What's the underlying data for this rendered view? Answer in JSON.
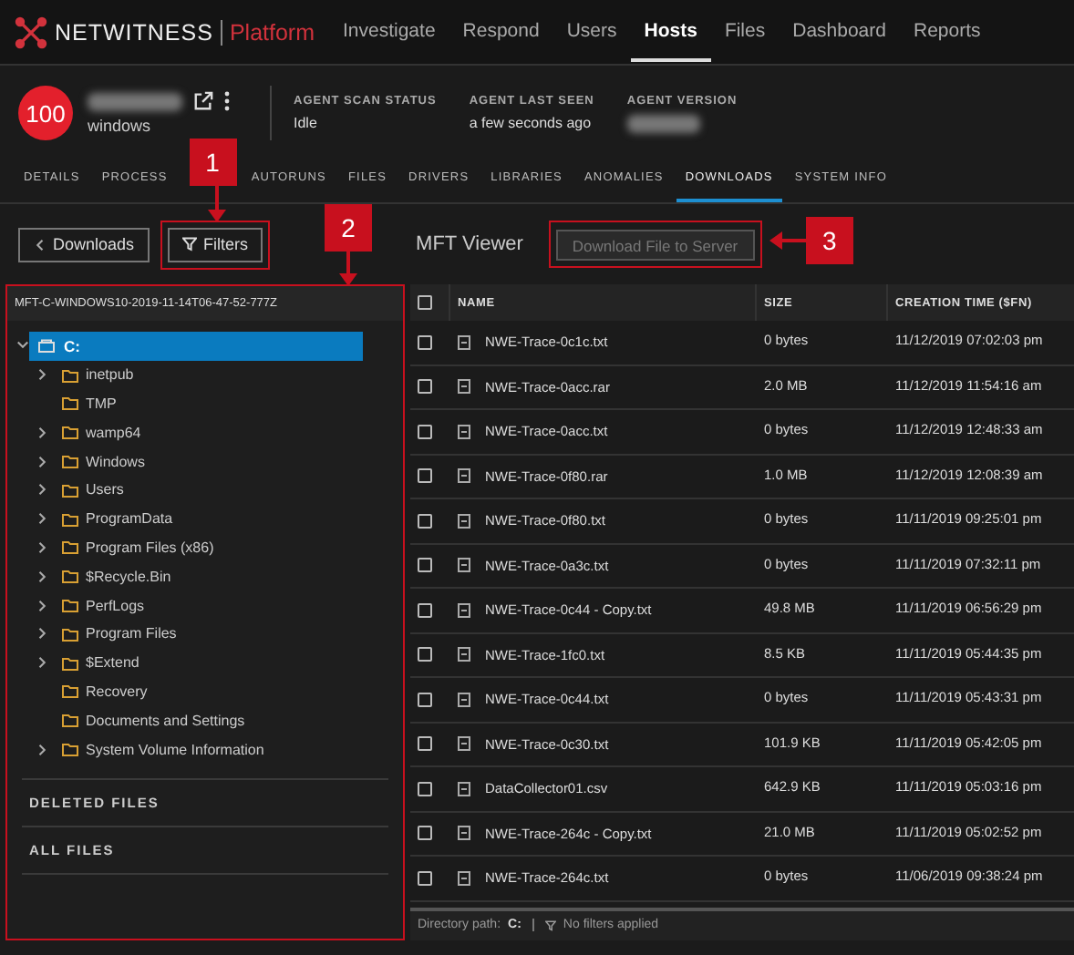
{
  "nav": {
    "brand": "NETWITNESS",
    "product": "Platform",
    "items": [
      {
        "label": "Investigate",
        "selected": false
      },
      {
        "label": "Respond",
        "selected": false
      },
      {
        "label": "Users",
        "selected": false
      },
      {
        "label": "Hosts",
        "selected": true
      },
      {
        "label": "Files",
        "selected": false
      },
      {
        "label": "Dashboard",
        "selected": false
      },
      {
        "label": "Reports",
        "selected": false
      }
    ]
  },
  "host": {
    "score": "100",
    "os": "windows",
    "fields": [
      {
        "label": "AGENT SCAN STATUS",
        "value": "Idle"
      },
      {
        "label": "AGENT LAST SEEN",
        "value": "a few seconds ago"
      },
      {
        "label": "AGENT VERSION"
      }
    ]
  },
  "tabs": [
    {
      "label": "DETAILS",
      "selected": false
    },
    {
      "label": "PROCESS",
      "selected": false
    },
    {
      "label": "AUTORUNS",
      "selected": false
    },
    {
      "label": "FILES",
      "selected": false
    },
    {
      "label": "DRIVERS",
      "selected": false
    },
    {
      "label": "LIBRARIES",
      "selected": false
    },
    {
      "label": "ANOMALIES",
      "selected": false
    },
    {
      "label": "DOWNLOADS",
      "selected": true
    },
    {
      "label": "SYSTEM INFO",
      "selected": false
    }
  ],
  "toolbar": {
    "back_button": "Downloads",
    "filter_button": {
      "label": "Filters",
      "callout": "1"
    },
    "title": "MFT Viewer",
    "download_button": {
      "label": "Download File to Server",
      "disabled": true,
      "callout": "3"
    }
  },
  "tree": {
    "callout": "2",
    "title": "MFT-C-WINDOWS10-2019-11-14T06-47-52-777Z",
    "root": {
      "label": "C:",
      "selected": true,
      "expanded": true,
      "children": [
        {
          "label": "inetpub",
          "expandable": true
        },
        {
          "label": "TMP",
          "expandable": false
        },
        {
          "label": "wamp64",
          "expandable": true
        },
        {
          "label": "Windows",
          "expandable": true
        },
        {
          "label": "Users",
          "expandable": true
        },
        {
          "label": "ProgramData",
          "expandable": true
        },
        {
          "label": "Program Files (x86)",
          "expandable": true
        },
        {
          "label": "$Recycle.Bin",
          "expandable": true
        },
        {
          "label": "PerfLogs",
          "expandable": true
        },
        {
          "label": "Program Files",
          "expandable": true
        },
        {
          "label": "$Extend",
          "expandable": true
        },
        {
          "label": "Recovery",
          "expandable": false
        },
        {
          "label": "Documents and Settings",
          "expandable": false
        },
        {
          "label": "System Volume Information",
          "expandable": true
        }
      ]
    },
    "sections": [
      "DELETED FILES",
      "ALL FILES"
    ]
  },
  "table": {
    "all_checked": false,
    "columns": [
      "NAME",
      "SIZE",
      "CREATION TIME ($FN)"
    ],
    "rows": [
      {
        "checked": false,
        "name": "NWE-Trace-0c1c.txt",
        "size": "0 bytes",
        "created": "11/12/2019 07:02:03 pm"
      },
      {
        "checked": false,
        "name": "NWE-Trace-0acc.rar",
        "size": "2.0 MB",
        "created": "11/12/2019 11:54:16 am"
      },
      {
        "checked": false,
        "name": "NWE-Trace-0acc.txt",
        "size": "0 bytes",
        "created": "11/12/2019 12:48:33 am"
      },
      {
        "checked": false,
        "name": "NWE-Trace-0f80.rar",
        "size": "1.0 MB",
        "created": "11/12/2019 12:08:39 am"
      },
      {
        "checked": false,
        "name": "NWE-Trace-0f80.txt",
        "size": "0 bytes",
        "created": "11/11/2019 09:25:01 pm"
      },
      {
        "checked": false,
        "name": "NWE-Trace-0a3c.txt",
        "size": "0 bytes",
        "created": "11/11/2019 07:32:11 pm"
      },
      {
        "checked": false,
        "name": "NWE-Trace-0c44 - Copy.txt",
        "size": "49.8 MB",
        "created": "11/11/2019 06:56:29 pm"
      },
      {
        "checked": false,
        "name": "NWE-Trace-1fc0.txt",
        "size": "8.5 KB",
        "created": "11/11/2019 05:44:35 pm"
      },
      {
        "checked": false,
        "name": "NWE-Trace-0c44.txt",
        "size": "0 bytes",
        "created": "11/11/2019 05:43:31 pm"
      },
      {
        "checked": false,
        "name": "NWE-Trace-0c30.txt",
        "size": "101.9 KB",
        "created": "11/11/2019 05:42:05 pm"
      },
      {
        "checked": false,
        "name": "DataCollector01.csv",
        "size": "642.9 KB",
        "created": "11/11/2019 05:03:16 pm"
      },
      {
        "checked": false,
        "name": "NWE-Trace-264c - Copy.txt",
        "size": "21.0 MB",
        "created": "11/11/2019 05:02:52 pm"
      },
      {
        "checked": false,
        "name": "NWE-Trace-264c.txt",
        "size": "0 bytes",
        "created": "11/06/2019 09:38:24 pm"
      }
    ]
  },
  "status": {
    "path_label": "Directory path:",
    "path": "C:",
    "filters": "No filters applied"
  }
}
